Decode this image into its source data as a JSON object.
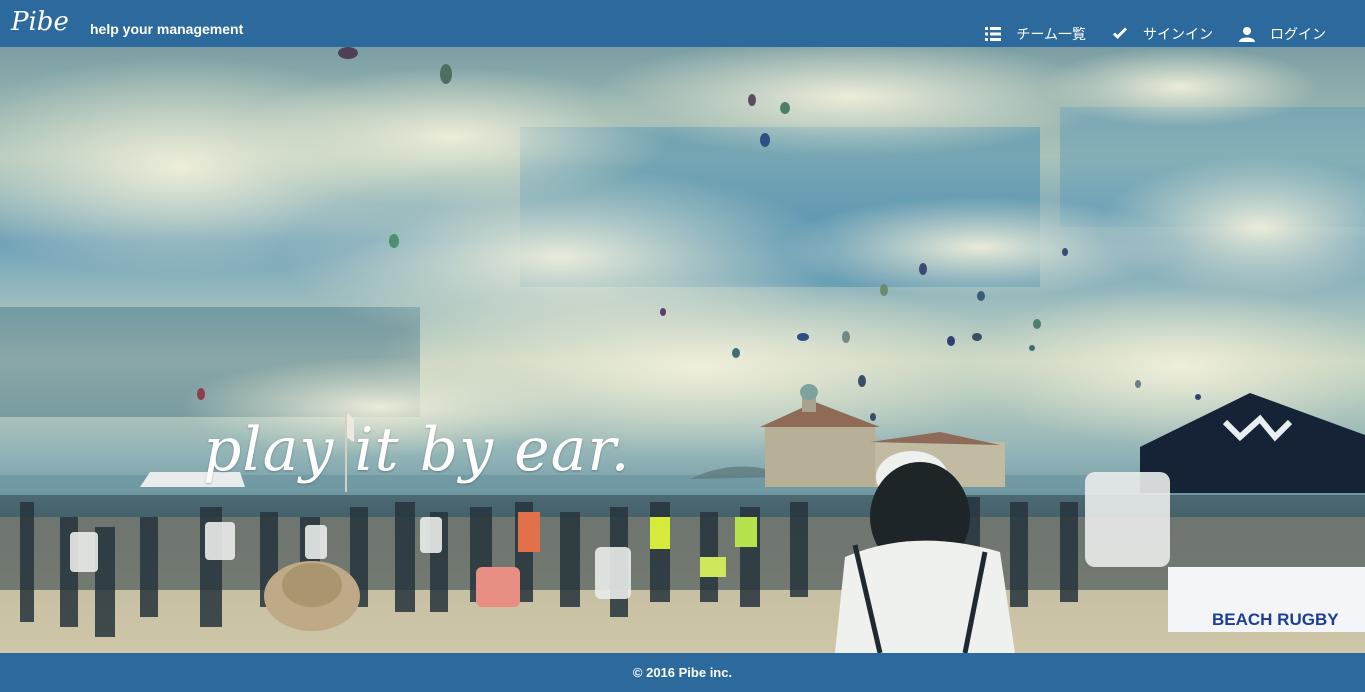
{
  "header": {
    "brand": "Pibe",
    "tagline": "help your management",
    "nav": [
      {
        "label": "チーム一覧",
        "icon": "list-icon"
      },
      {
        "label": "サインイン",
        "icon": "checkmark-icon"
      },
      {
        "label": "ログイン",
        "icon": "user-icon"
      }
    ]
  },
  "hero": {
    "slogan": "play it by ear.",
    "banner_text": "BEACH RUGBY"
  },
  "footer": {
    "copyright": "© 2016 Pibe inc."
  }
}
